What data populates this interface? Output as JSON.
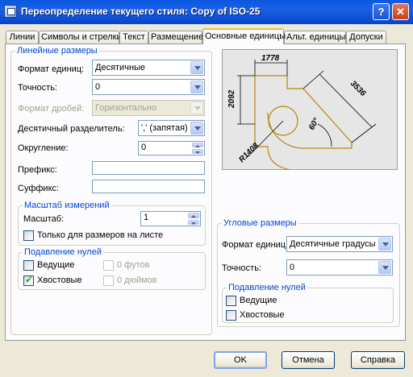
{
  "window": {
    "title": "Переопределение текущего стиля: Copy of ISO-25",
    "help_glyph": "?",
    "close_glyph": "✕"
  },
  "tabs": [
    {
      "label": "Линии"
    },
    {
      "label": "Символы и стрелки"
    },
    {
      "label": "Текст"
    },
    {
      "label": "Размещение"
    },
    {
      "label": "Основные единицы"
    },
    {
      "label": "Альт. единицы"
    },
    {
      "label": "Допуски"
    }
  ],
  "active_tab": "Основные единицы",
  "linear": {
    "legend": "Линейные размеры",
    "unit_format": {
      "label": "Формат единиц:",
      "value": "Десятичные"
    },
    "precision": {
      "label": "Точность:",
      "value": "0"
    },
    "fraction_format": {
      "label": "Формат дробей:",
      "value": "Горизонтально",
      "enabled": false
    },
    "decimal_separator": {
      "label": "Десятичный разделитель:",
      "value": "',' (запятая)"
    },
    "round_off": {
      "label": "Округление:",
      "value": "0"
    },
    "prefix": {
      "label": "Префикс:",
      "value": ""
    },
    "suffix": {
      "label": "Суффикс:",
      "value": ""
    }
  },
  "scale": {
    "legend": "Масштаб измерений",
    "label": "Масштаб:",
    "value": "1",
    "layout_only": {
      "label": "Только для размеров на листе",
      "checked": false
    }
  },
  "zero_suppression": {
    "legend": "Подавление нулей",
    "leading": {
      "label": "Ведущие",
      "checked": false
    },
    "trailing": {
      "label": "Хвостовые",
      "checked": true
    },
    "feet": {
      "label": "0 футов",
      "checked": false,
      "enabled": false
    },
    "inches": {
      "label": "0 дюймов",
      "checked": false,
      "enabled": false
    }
  },
  "angular": {
    "legend": "Угловые размеры",
    "unit_format": {
      "label": "Формат единиц:",
      "value": "Десятичные градусы"
    },
    "precision": {
      "label": "Точность:",
      "value": "0"
    },
    "zero_suppression": {
      "legend": "Подавление нулей",
      "leading": {
        "label": "Ведущие",
        "checked": false
      },
      "trailing": {
        "label": "Хвостовые",
        "checked": false
      }
    }
  },
  "preview": {
    "dim_top": "1778",
    "dim_left": "2092",
    "dim_diag": "3536",
    "dim_angle": "60°",
    "dim_radius": "R1408",
    "colors": {
      "geometry": "#b8860b",
      "dimension": "#000000",
      "background": "#e6e6e6"
    }
  },
  "buttons": {
    "ok": "OK",
    "cancel": "Отмена",
    "help": "Справка"
  }
}
